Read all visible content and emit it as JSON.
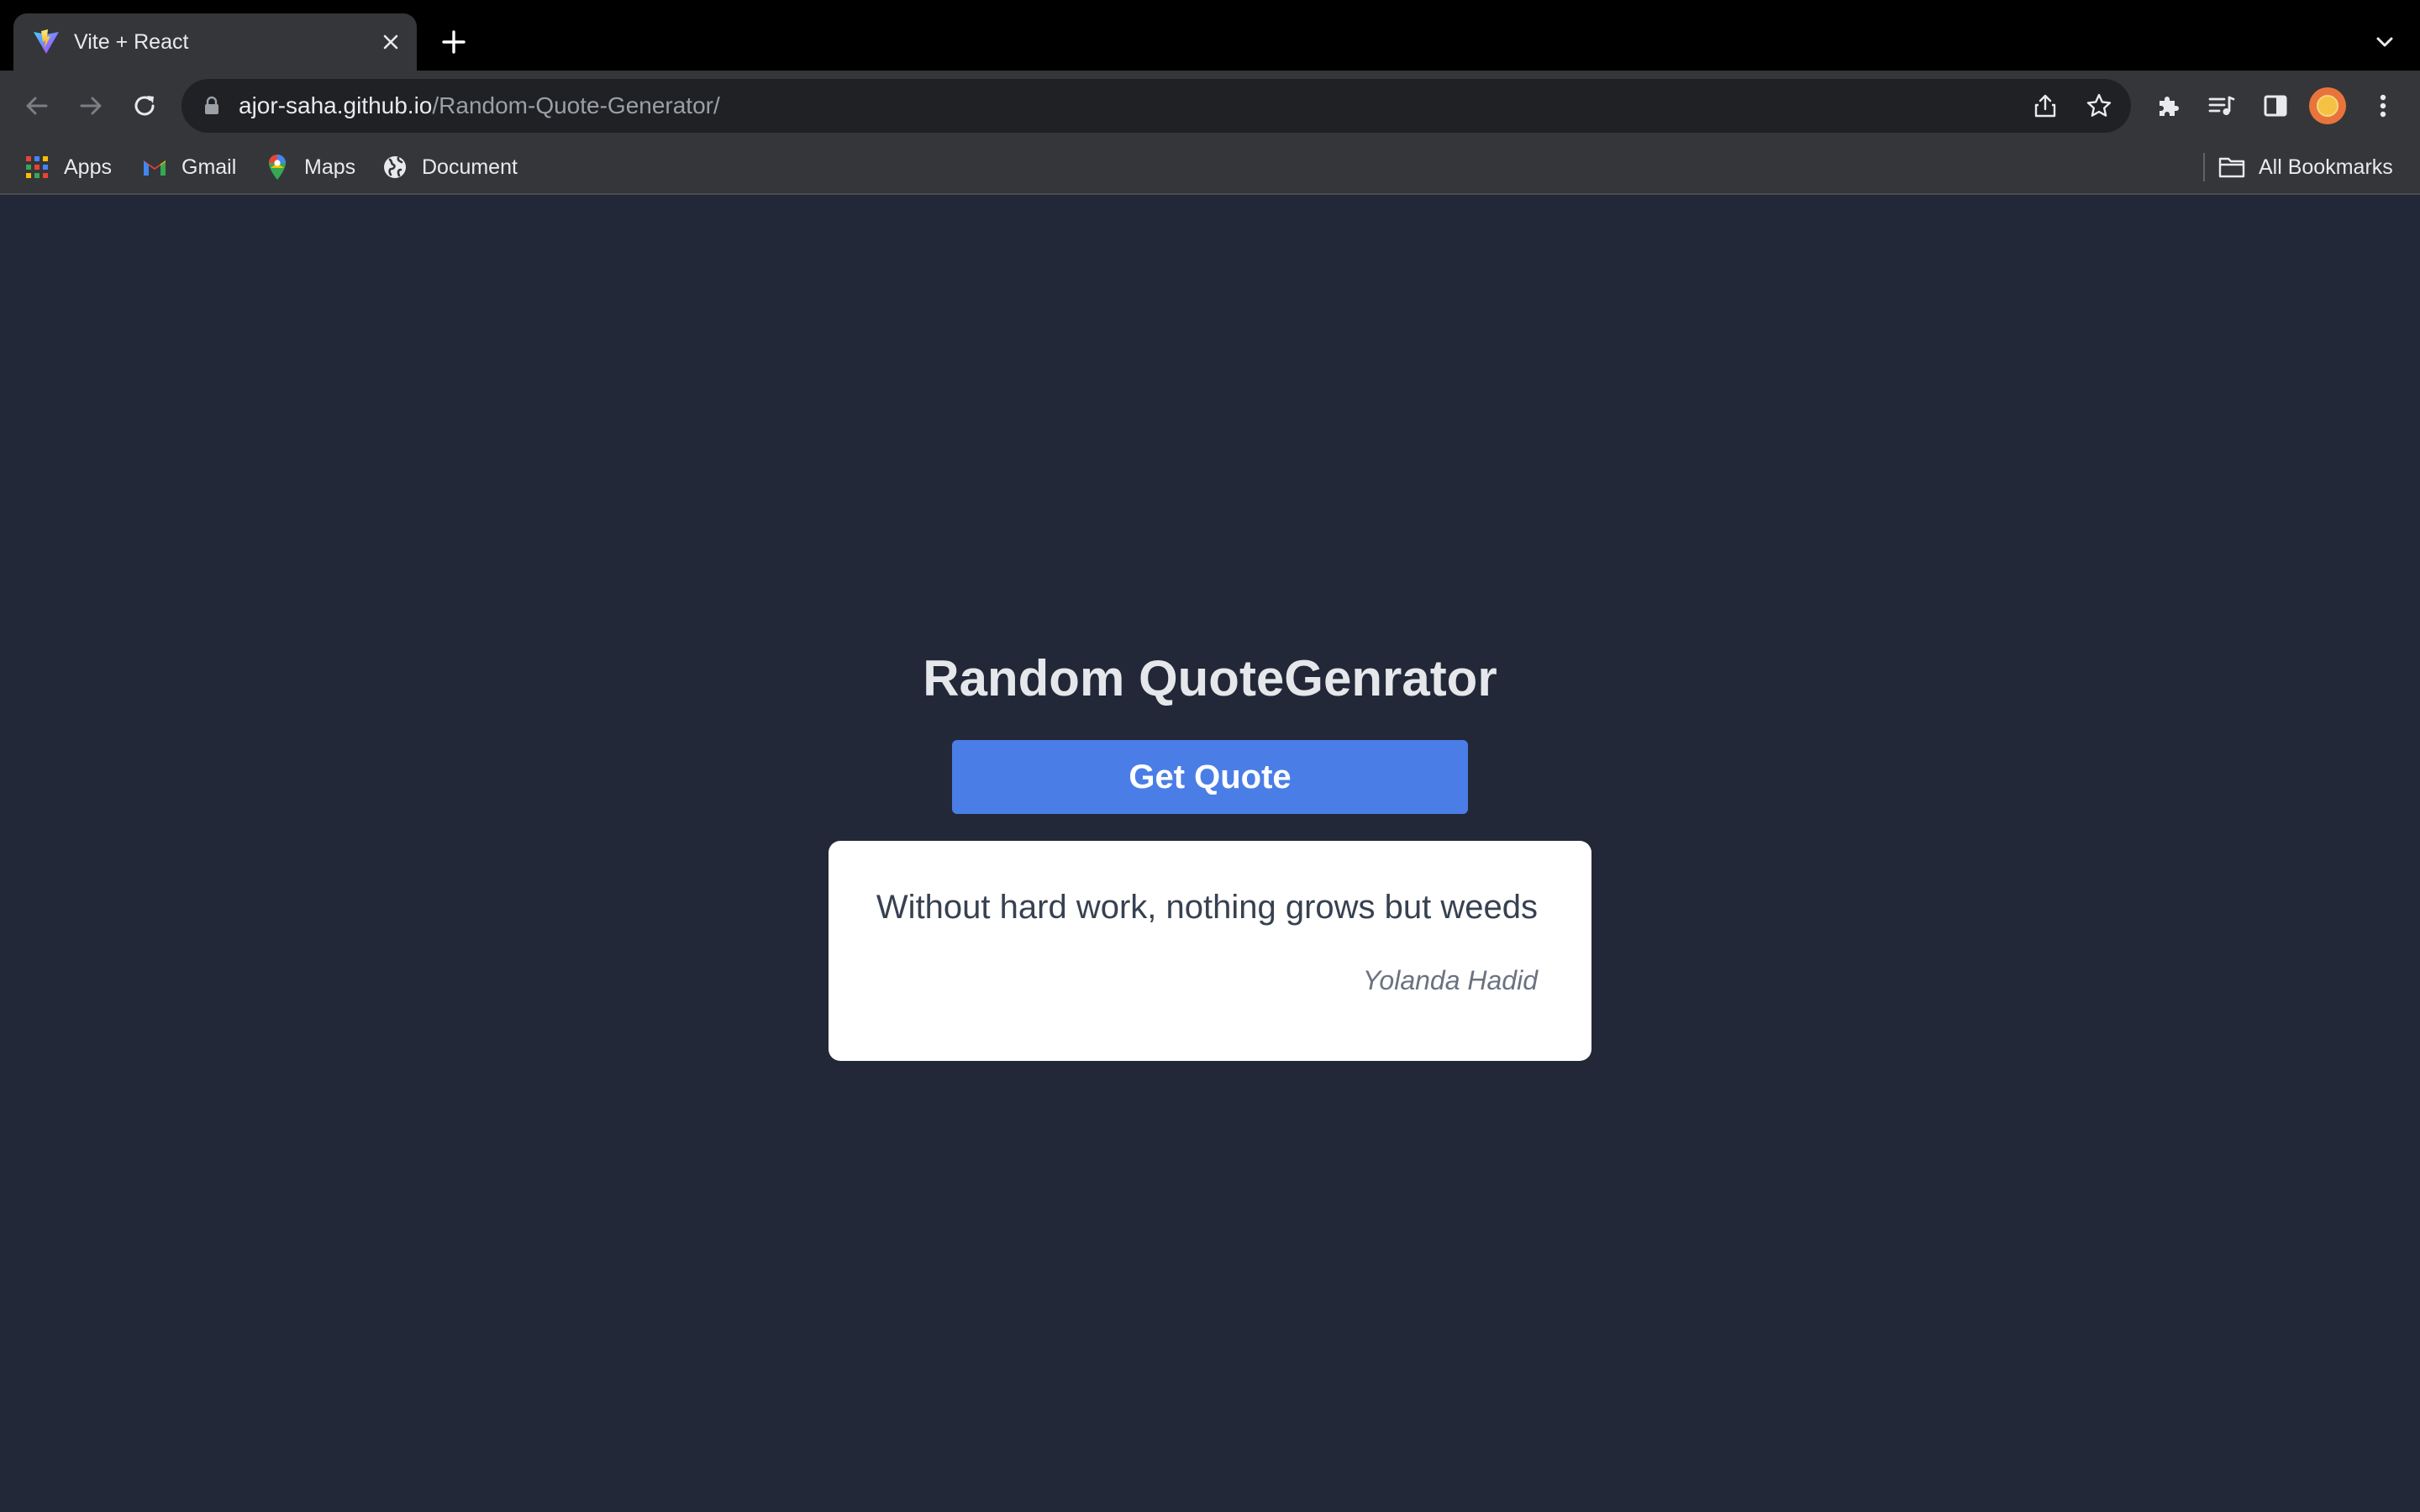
{
  "browser": {
    "tab": {
      "title": "Vite + React"
    },
    "address_bar": {
      "domain": "ajor-saha.github.io",
      "path": "/Random-Quote-Generator/"
    },
    "bookmarks": [
      {
        "label": "Apps",
        "icon": "apps-grid-icon"
      },
      {
        "label": "Gmail",
        "icon": "gmail-icon"
      },
      {
        "label": "Maps",
        "icon": "maps-icon"
      },
      {
        "label": "Document",
        "icon": "globe-icon"
      }
    ],
    "all_bookmarks_label": "All Bookmarks",
    "colors": {
      "tab_strip": "#000000",
      "toolbar": "#35363a",
      "omnibox": "#202124"
    }
  },
  "app": {
    "heading": "Random QuoteGenrator",
    "button_label": "Get Quote",
    "quote": {
      "text": "Without hard work, nothing grows but weeds",
      "author": "Yolanda Hadid"
    },
    "colors": {
      "background": "#222837",
      "button": "#4a7ee6",
      "card": "#ffffff",
      "quote_text": "#374151",
      "author_text": "#6b7280"
    }
  }
}
